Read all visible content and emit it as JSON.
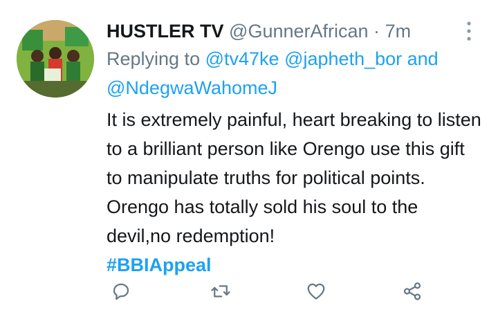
{
  "tweet": {
    "display_name": "HUSTLER TV",
    "handle": "@GunnerAfrican",
    "separator": "·",
    "time": "7m",
    "replying_prefix": "Replying to",
    "mention_1": "@tv47ke",
    "mention_2": "@japheth_bor",
    "and_word": "and",
    "mention_3": "@NdegwaWahomeJ",
    "body_text": "It is extremely painful, heart breaking to listen to a brilliant person like Orengo use this gift to manipulate truths for political points. Orengo has totally sold his soul to the devil,no redemption!",
    "hashtag": "#BBIAppeal"
  },
  "colors": {
    "accent": "#1da1f2",
    "muted": "#657786",
    "text": "#14171a"
  },
  "icons": {
    "reply": "reply-icon",
    "retweet": "retweet-icon",
    "like": "heart-icon",
    "share": "share-icon",
    "more": "more-vertical-icon"
  }
}
